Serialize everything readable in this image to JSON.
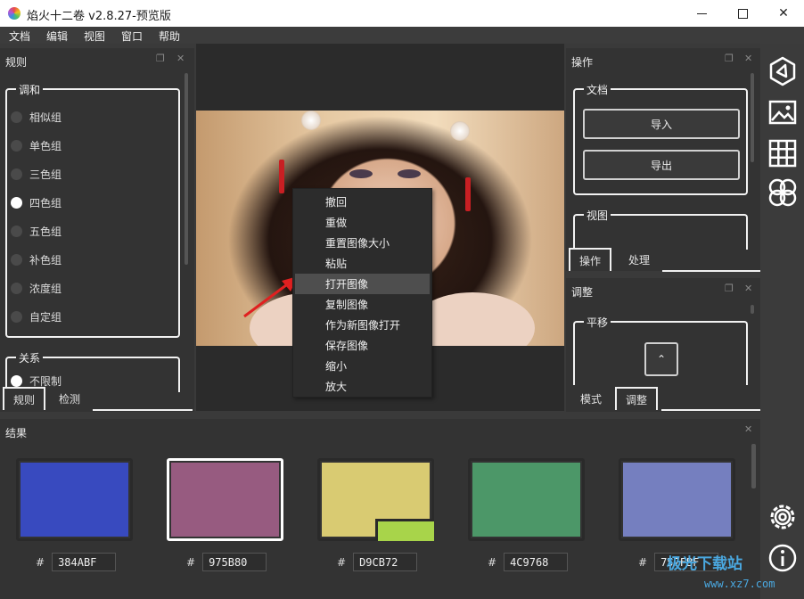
{
  "window": {
    "title": "焰火十二卷 v2.8.27-预览版",
    "minimize_glyph": "—",
    "maximize_glyph": "☐",
    "close_glyph": "✕"
  },
  "menu": [
    "文档",
    "编辑",
    "视图",
    "窗口",
    "帮助"
  ],
  "rules_panel": {
    "title": "规则",
    "harmony_group": {
      "title": "调和",
      "options": [
        "相似组",
        "单色组",
        "三色组",
        "四色组",
        "五色组",
        "补色组",
        "浓度组",
        "自定组"
      ],
      "selected": "四色组"
    },
    "relation_group": {
      "title": "关系",
      "first_option": "不限制"
    },
    "tabs": [
      "规则",
      "检测"
    ],
    "active_tab": "规则"
  },
  "operations_panel": {
    "title": "操作",
    "document_group": {
      "title": "文档",
      "buttons": [
        "导入",
        "导出"
      ]
    },
    "view_group": {
      "title": "视图"
    },
    "tabs": [
      "操作",
      "处理"
    ],
    "active_tab": "操作"
  },
  "adjust_panel": {
    "title": "调整",
    "pan_group": {
      "title": "平移",
      "up_glyph": "⌃"
    },
    "tabs": [
      "模式",
      "调整"
    ],
    "active_tab": "调整"
  },
  "context_menu": {
    "items": [
      "撤回",
      "重做",
      "重置图像大小",
      "粘贴",
      "打开图像",
      "复制图像",
      "作为新图像打开",
      "保存图像",
      "缩小",
      "放大"
    ],
    "highlighted": "打开图像"
  },
  "results_panel": {
    "title": "结果",
    "hash_symbol": "#",
    "swatches": [
      {
        "hex": "384ABF",
        "color": "#384ABF",
        "selected": false
      },
      {
        "hex": "975B80",
        "color": "#975B80",
        "selected": true
      },
      {
        "hex": "D9CB72",
        "color": "#D9CB72",
        "selected": false,
        "overlay_color": "#A8D44A"
      },
      {
        "hex": "4C9768",
        "color": "#4C9768",
        "selected": false
      },
      {
        "hex": "757FBF",
        "color": "#757FBF",
        "selected": false
      }
    ]
  },
  "right_toolbar": {
    "icons": [
      "triangle-hexagon-icon",
      "image-icon",
      "grid-icon",
      "quad-circle-icon",
      "settings-icon",
      "info-icon"
    ]
  },
  "watermark": {
    "line1": "极光下载站",
    "line2": "www.xz7.com"
  },
  "colors": {
    "accent": "#f0f0f0",
    "panel_bg": "#333333",
    "arrow": "#e02020"
  }
}
